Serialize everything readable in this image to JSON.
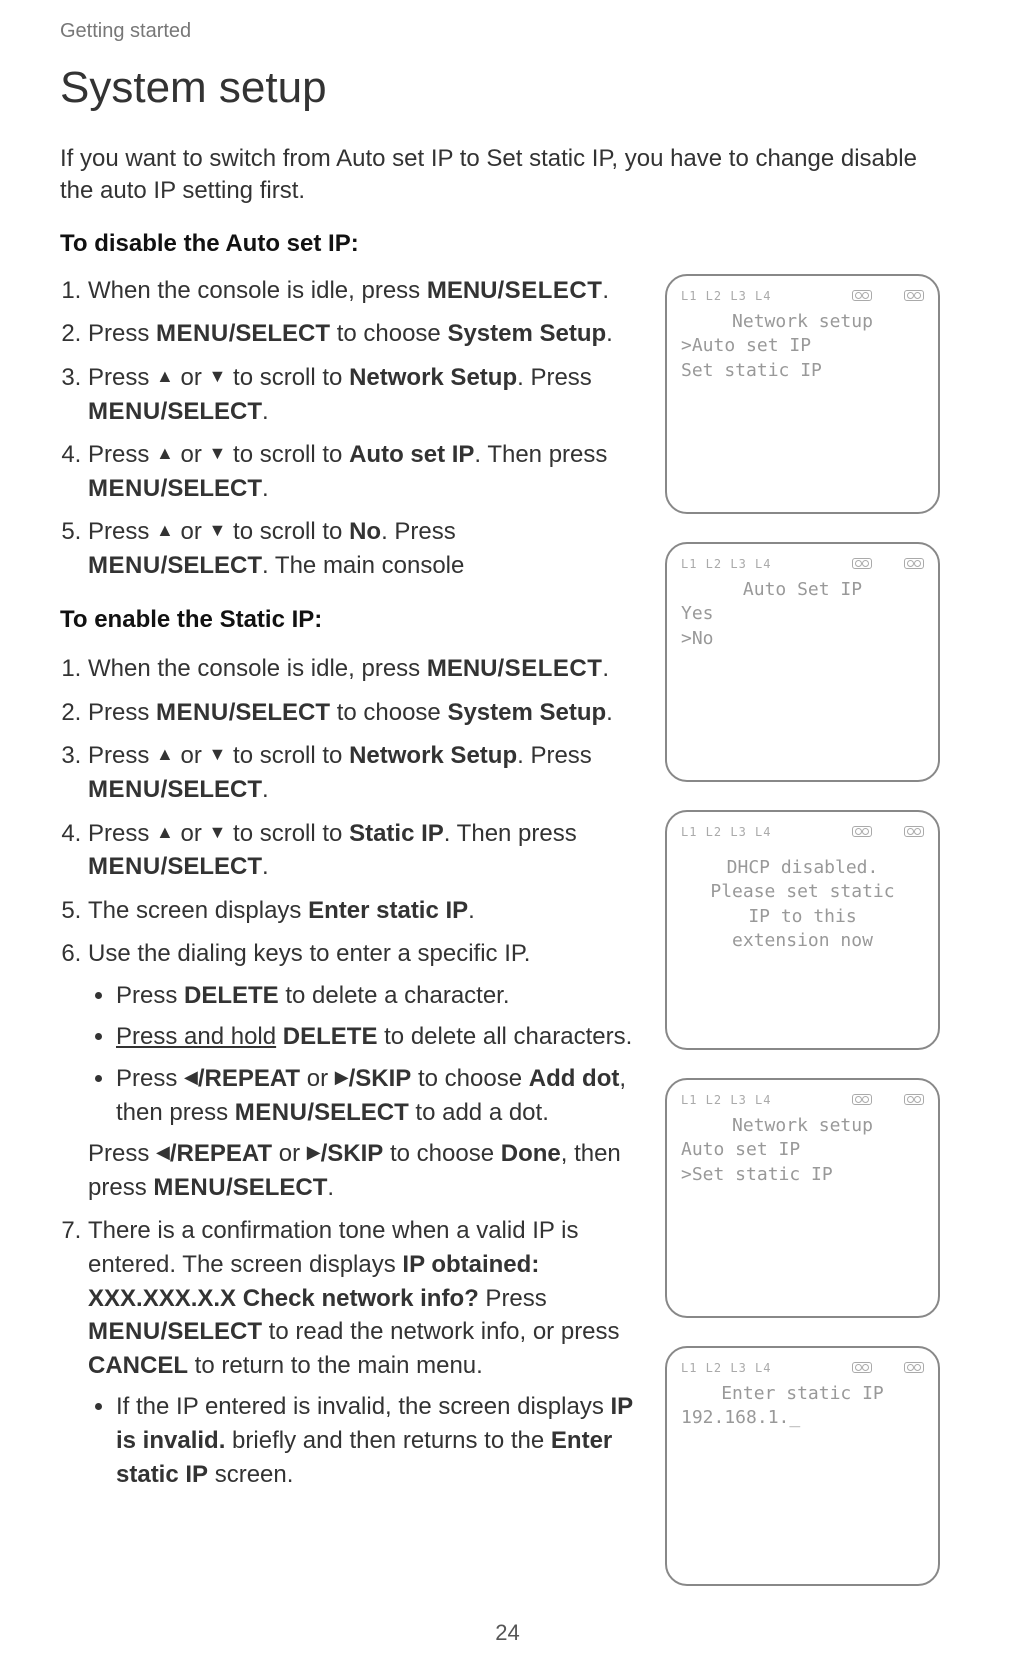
{
  "header": "Getting started",
  "title": "System setup",
  "intro": "If you want to switch from Auto set IP to Set static IP, you have to change disable the auto IP setting first.",
  "section1_heading": "To disable the Auto set IP:",
  "steps1": {
    "s1_a": "When the console is idle, press ",
    "s1_b": "MENU",
    "s1_c": "/SELECT",
    "s1_d": ".",
    "s2_a": "Press ",
    "s2_b": "MENU",
    "s2_c": "/SELECT",
    "s2_d": " to choose ",
    "s2_e": "System Setup",
    "s2_f": ".",
    "s3_a": "Press ",
    "s3_b": "▲",
    "s3_c": " or ",
    "s3_d": "▼",
    "s3_e": " to scroll to ",
    "s3_f": "Network Setup",
    "s3_g": ". Press ",
    "s3_h": "MENU",
    "s3_i": "/SELECT",
    "s3_j": ".",
    "s4_a": "Press ",
    "s4_b": "▲",
    "s4_c": " or ",
    "s4_d": "▼",
    "s4_e": " to scroll to ",
    "s4_f": "Auto set IP",
    "s4_g": ". Then press ",
    "s4_h": "MENU",
    "s4_i": "/SELECT",
    "s4_j": ".",
    "s5_a": "Press ",
    "s5_b": "▲",
    "s5_c": " or ",
    "s5_d": "▼",
    "s5_e": " to scroll to ",
    "s5_f": "No",
    "s5_g": ". Press ",
    "s5_h": "MENU",
    "s5_i": "/SELECT",
    "s5_j": ". The main console"
  },
  "section2_heading": "To enable the Static IP:",
  "steps2": {
    "s1_a": "When the console is idle, press ",
    "s1_b": "MENU",
    "s1_c": "/SELECT",
    "s1_d": ".",
    "s2_a": "Press ",
    "s2_b": "MENU",
    "s2_c": "/SELECT",
    "s2_d": " to choose ",
    "s2_e": "System Setup",
    "s2_f": ".",
    "s3_a": "Press ",
    "s3_b": "▲",
    "s3_c": " or ",
    "s3_d": "▼",
    "s3_e": " to scroll to ",
    "s3_f": "Network Setup",
    "s3_g": ". Press ",
    "s3_h": "MENU",
    "s3_i": "/SELECT",
    "s3_j": ".",
    "s4_a": "Press ",
    "s4_b": "▲",
    "s4_c": " or ",
    "s4_d": "▼",
    "s4_e": " to scroll to ",
    "s4_f": "Static IP",
    "s4_g": ". Then press ",
    "s4_h": "MENU",
    "s4_i": "/SELECT",
    "s4_j": ".",
    "s5_a": "The screen displays ",
    "s5_b": "Enter static IP",
    "s5_c": ".",
    "s6": "Use the dialing keys to enter a specific IP.",
    "b1_a": "Press ",
    "b1_b": "DELETE",
    "b1_c": " to delete a character.",
    "b2_a": "Press and hold",
    "b2_b": " ",
    "b2_c": "DELETE",
    "b2_d": " to delete all characters.",
    "b3_a": "Press ",
    "b3_b": "◀",
    "b3_c": "/REPEAT",
    "b3_d": " or ",
    "b3_e": "▶",
    "b3_f": "/SKIP",
    "b3_g": " to choose ",
    "b3_h": "Add dot",
    "b3_i": ", then press ",
    "b3_j": "MENU",
    "b3_k": "/SELECT",
    "b3_l": " to add a dot.",
    "done_a": "Press ",
    "done_b": "◀",
    "done_c": "/REPEAT",
    "done_d": " or ",
    "done_e": "▶",
    "done_f": "/SKIP",
    "done_g": " to choose ",
    "done_h": "Done",
    "done_i": ", then press ",
    "done_j": "MENU",
    "done_k": "/SELECT",
    "done_l": ".",
    "s7_a": "There is a confirmation tone when a valid IP is entered. The screen displays ",
    "s7_b": "IP obtained: XXX.XXX.X.X Check network info?",
    "s7_c": " Press ",
    "s7_d": "MENU",
    "s7_e": "/SELECT",
    "s7_f": " to read the network info, or press ",
    "s7_g": "CANCEL",
    "s7_h": " to return to the main menu.",
    "inv_a": "If the IP entered is invalid, the screen displays ",
    "inv_b": "IP is invalid.",
    "inv_c": " briefly and then returns to the ",
    "inv_d": "Enter static IP",
    "inv_e": " screen."
  },
  "screens": {
    "icons_labels": "L1 L2 L3 L4",
    "scr1": {
      "title": "Network setup",
      "l1": ">Auto set IP",
      "l2": " Set static IP"
    },
    "scr2": {
      "title": "Auto Set IP",
      "l1": " Yes",
      "l2": ">No"
    },
    "scr3": {
      "l1": "DHCP disabled.",
      "l2": "Please set static",
      "l3": "IP to this",
      "l4": "extension now"
    },
    "scr4": {
      "title": "Network setup",
      "l1": " Auto set IP",
      "l2": ">Set static IP"
    },
    "scr5": {
      "title": "Enter static IP",
      "l1": "192.168.1._"
    }
  },
  "page_number": "24"
}
